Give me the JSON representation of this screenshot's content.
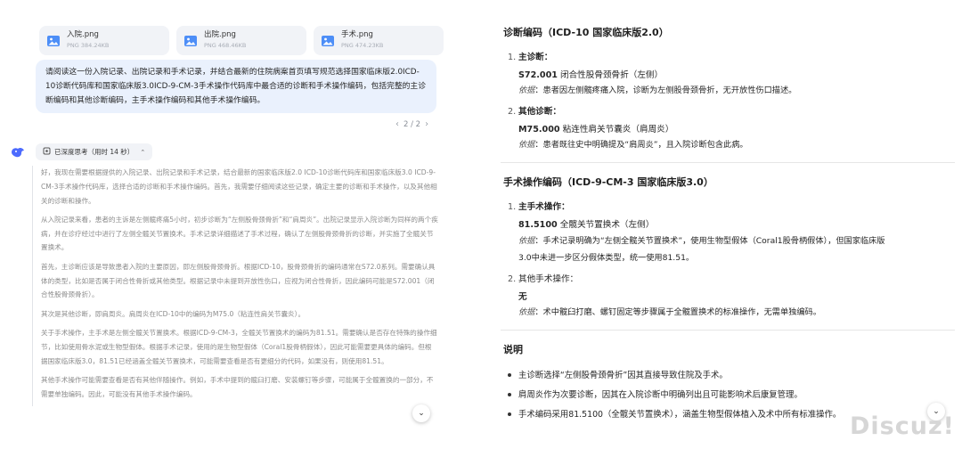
{
  "attachments": [
    {
      "name": "入院.png",
      "size": "PNG 384.24KB"
    },
    {
      "name": "出院.png",
      "size": "PNG 468.46KB"
    },
    {
      "name": "手术.png",
      "size": "PNG 474.23KB"
    }
  ],
  "user_message": "请阅读这一份入院记录、出院记录和手术记录，并结合最新的住院病案首页填写规范选择国家临床版2.0ICD-10诊断代码库和国家临床版3.0ICD-9-CM-3手术操作代码库中最合适的诊断和手术操作编码，包括完整的主诊断编码和其他诊断编码，主手术操作编码和其他手术操作编码。",
  "pager": {
    "prev": "‹",
    "label": "2 / 2",
    "next": "›"
  },
  "thinking": {
    "label": "已深度思考（用时 14 秒）",
    "paragraphs": [
      "好，我现在需要根据提供的入院记录、出院记录和手术记录，结合最新的国家临床版2.0 ICD-10诊断代码库和国家临床版3.0 ICD-9-CM-3手术操作代码库，选择合适的诊断和手术操作编码。首先，我需要仔细阅读这些记录，确定主要的诊断和手术操作，以及其他相关的诊断和操作。",
      "从入院记录来看，患者的主诉是左侧髋疼痛5小时，初步诊断为“左侧股骨颈骨折”和“肩周炎”。出院记录显示入院诊断为同样的两个疾病，并在诊疗经过中进行了左侧全髋关节置换术。手术记录详细描述了手术过程，确认了左侧股骨颈骨折的诊断，并实施了全髋关节置换术。",
      "首先，主诊断应该是导致患者入院的主要原因，即左侧股骨颈骨折。根据ICD-10，股骨颈骨折的编码通常在S72.0系列。需要确认具体的类型，比如是否属于闭合性骨折或其他类型。根据记录中未提到开放性伤口，应视为闭合性骨折，因此编码可能是S72.001（闭合性股骨颈骨折）。",
      "其次是其他诊断，即肩周炎。肩周炎在ICD-10中的编码为M75.0（粘连性肩关节囊炎）。",
      "关于手术操作，主手术是左侧全髋关节置换术。根据ICD-9-CM-3，全髋关节置换术的编码为81.51。需要确认是否存在特殊的操作细节，比如使用骨水泥或生物型假体。根据手术记录，使用的是生物型假体（Coral1股骨柄假体），因此可能需要更具体的编码。但根据国家临床版3.0，81.51已经涵盖全髋关节置换术，可能需要查看是否有更细分的代码，如果没有，则使用81.51。",
      "其他手术操作可能需要查看是否有其他伴随操作。例如，手术中提到的髋臼打磨、安装螺钉等步骤，可能属于全髋置换的一部分，不需要单独编码。因此，可能没有其他手术操作编码。"
    ]
  },
  "answer": {
    "diag_title": "诊断编码（ICD-10 国家临床版2.0）",
    "diag_main_label": "主诊断：",
    "diag_main_code": "S72.001",
    "diag_main_desc": "闭合性股骨颈骨折（左侧）",
    "basis_label": "依据",
    "diag_main_basis": "：患者因左侧髋疼痛入院，诊断为左侧股骨颈骨折，无开放性伤口描述。",
    "diag_other_label": "其他诊断：",
    "diag_other_code": "M75.000",
    "diag_other_desc": "粘连性肩关节囊炎（肩周炎）",
    "diag_other_basis": "：患者既往史中明确提及“肩周炎”，且入院诊断包含此病。",
    "op_title": "手术操作编码（ICD-9-CM-3 国家临床版3.0）",
    "op_main_label": "主手术操作：",
    "op_main_code": "81.5100",
    "op_main_desc": "全髋关节置换术（左侧）",
    "op_main_basis_1": "：手术记录明确为“左侧全髋关节置换术”，使用生物型假体（Coral1股骨柄假体），但国家临床版",
    "op_main_basis_2": "3.0中未进一步区分假体类型，统一使用81.51。",
    "op_other_label": "其他手术操作：",
    "op_other_value": "无",
    "op_other_basis": "：术中髋臼打磨、螺钉固定等步骤属于全髋置换术的标准操作，无需单独编码。",
    "note_title": "说明",
    "notes": [
      "主诊断选择“左侧股骨颈骨折”因其直接导致住院及手术。",
      "肩周炎作为次要诊断，因其在入院诊断中明确列出且可能影响术后康复管理。",
      "手术编码采用81.5100（全髋关节置换术），涵盖生物型假体植入及术中所有标准操作。"
    ]
  },
  "watermark": "Discuz!",
  "colors": {
    "bubble_bg": "#eaf1fd",
    "card_bg": "#f1f3f7",
    "accent": "#4d6bfe",
    "thinking_text": "#8b8b8b"
  }
}
